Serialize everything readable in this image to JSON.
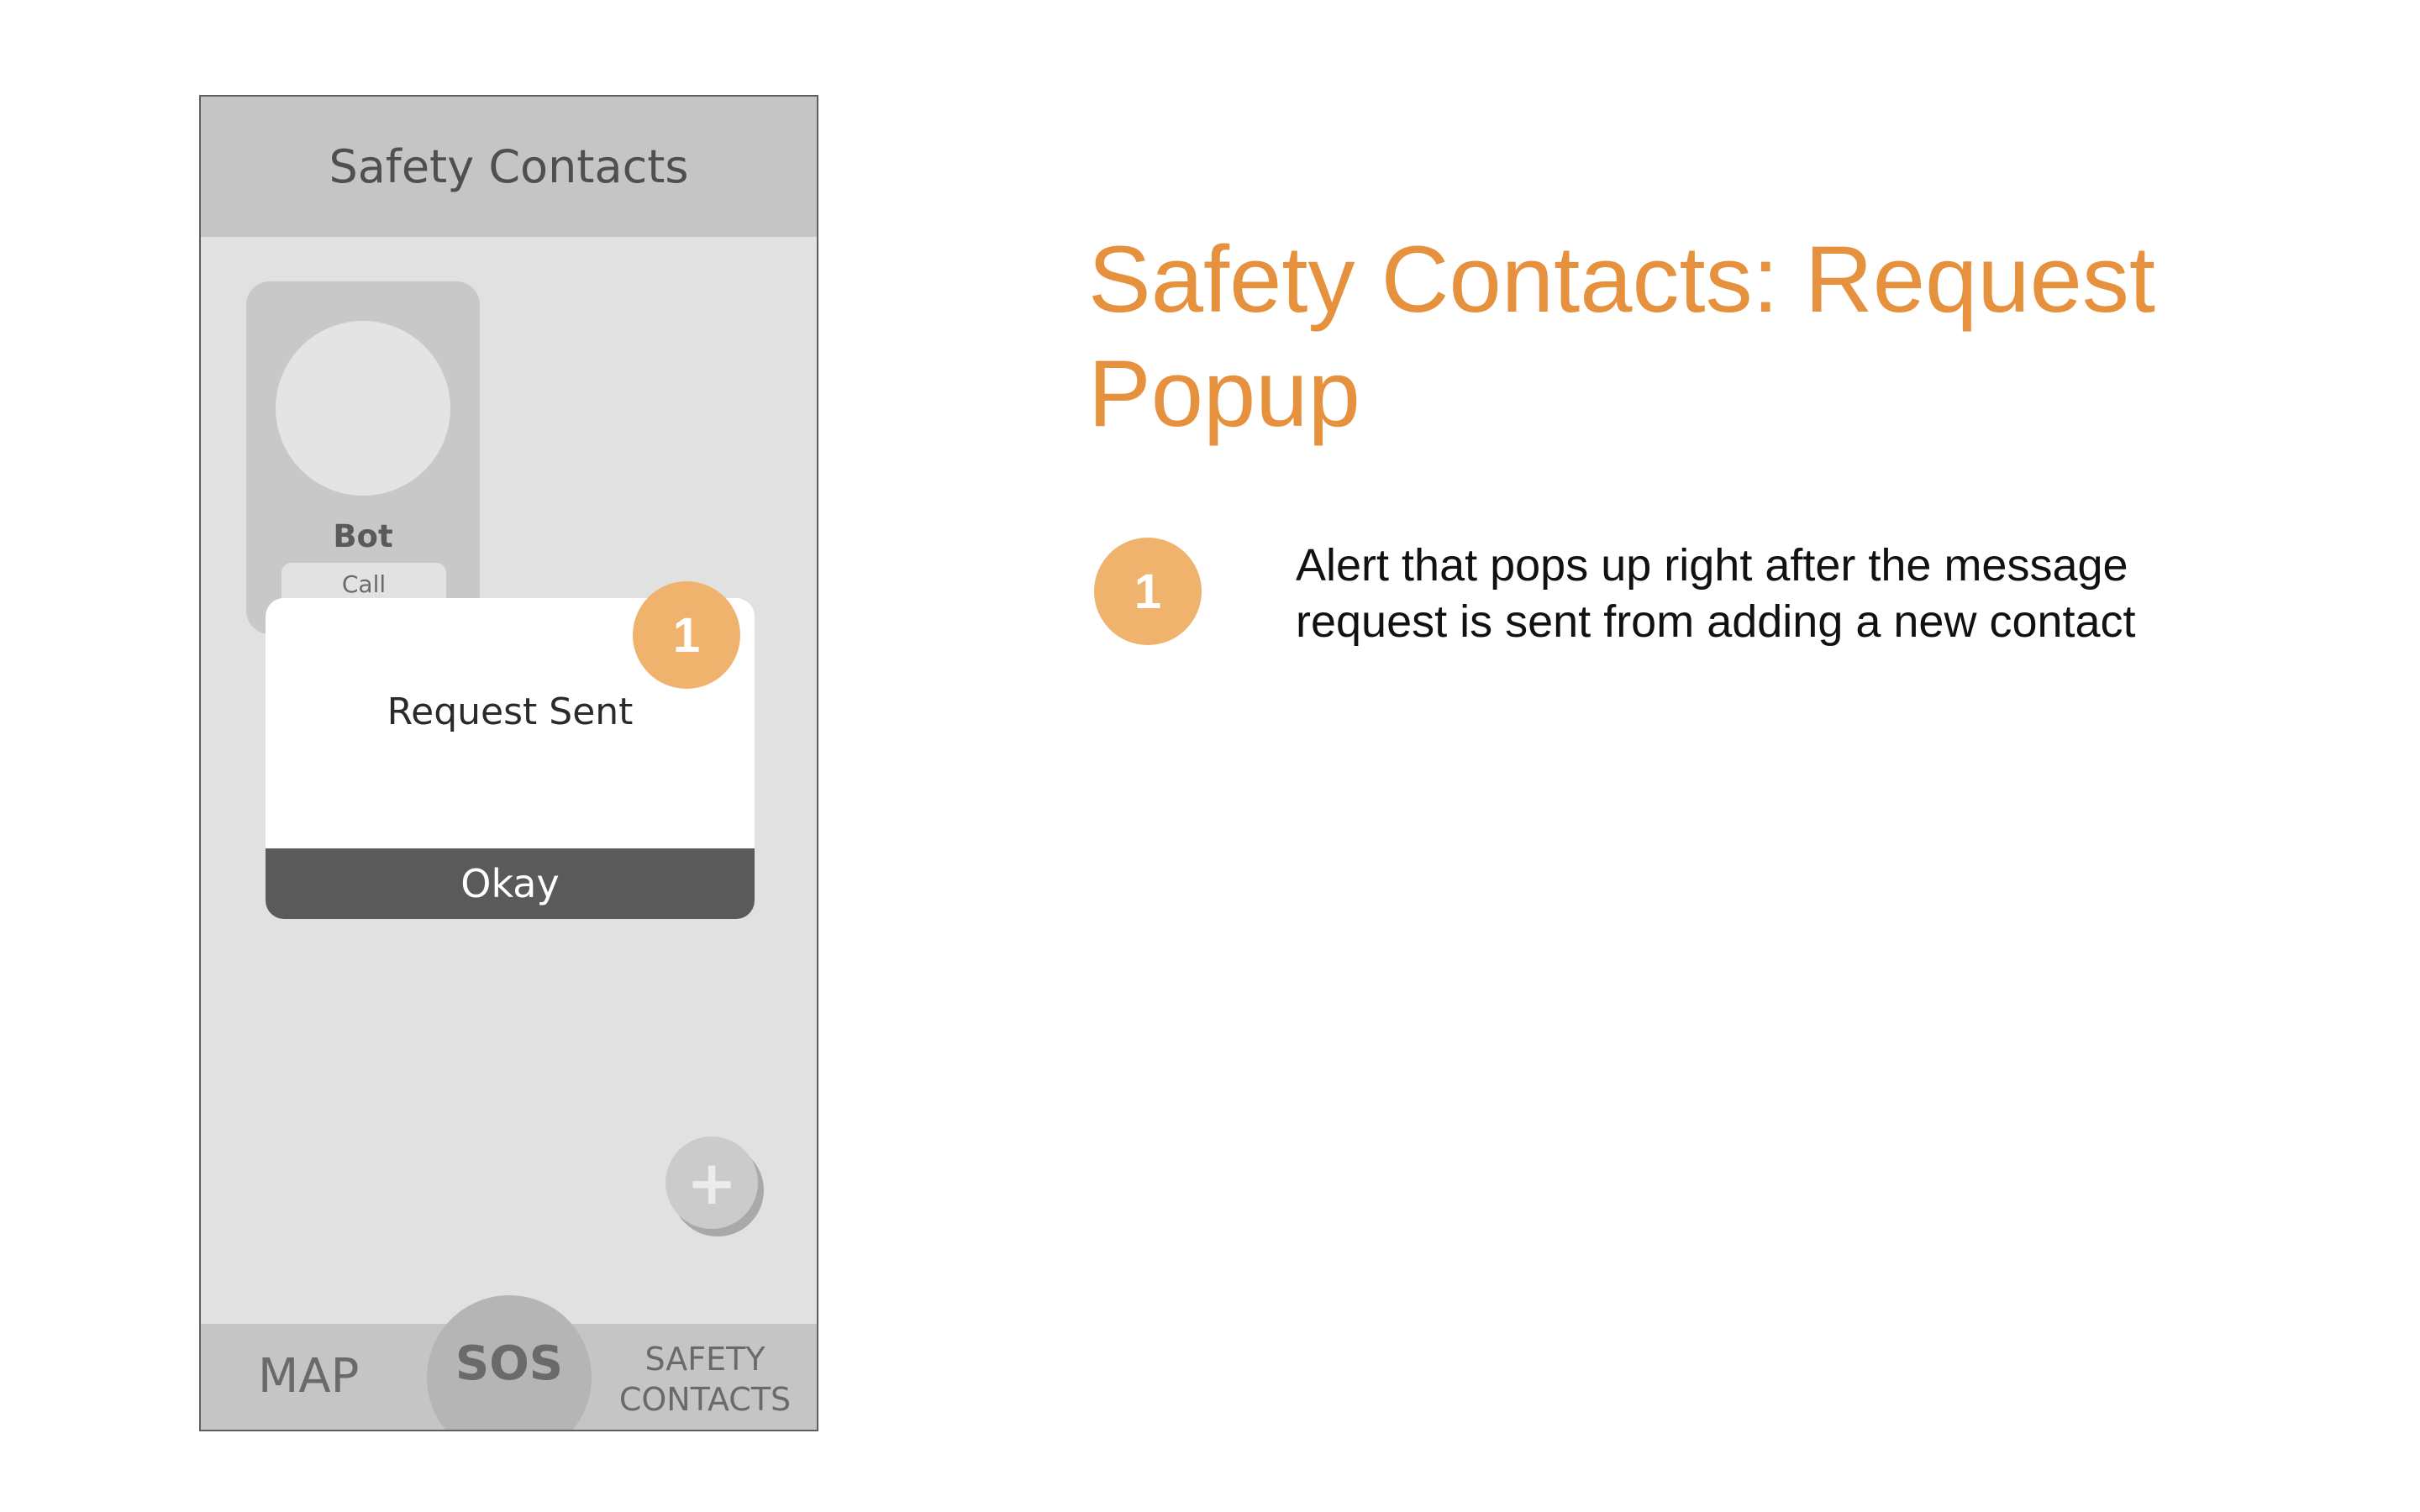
{
  "screen": {
    "title": "Safety Contacts",
    "contact": {
      "name": "Bot",
      "call_label": "Call"
    },
    "popup": {
      "message": "Request Sent",
      "button_label": "Okay",
      "badge_number": "1"
    },
    "fab_label": "+",
    "tabbar": {
      "map_label": "MAP",
      "sos_label": "SOS",
      "safety_label": "SAFETY CONTACTS"
    }
  },
  "annotation": {
    "heading": "Safety Contacts: Request Popup",
    "note_number": "1",
    "note_text": "Alert that pops up right after the message request is sent from adding a new contact"
  },
  "colors": {
    "accent": "#e6913d",
    "badge": "#f0b36e",
    "phone_background": "#e1e1e1",
    "header_background": "#c5c5c5",
    "popup_button": "#5a5a5a"
  }
}
